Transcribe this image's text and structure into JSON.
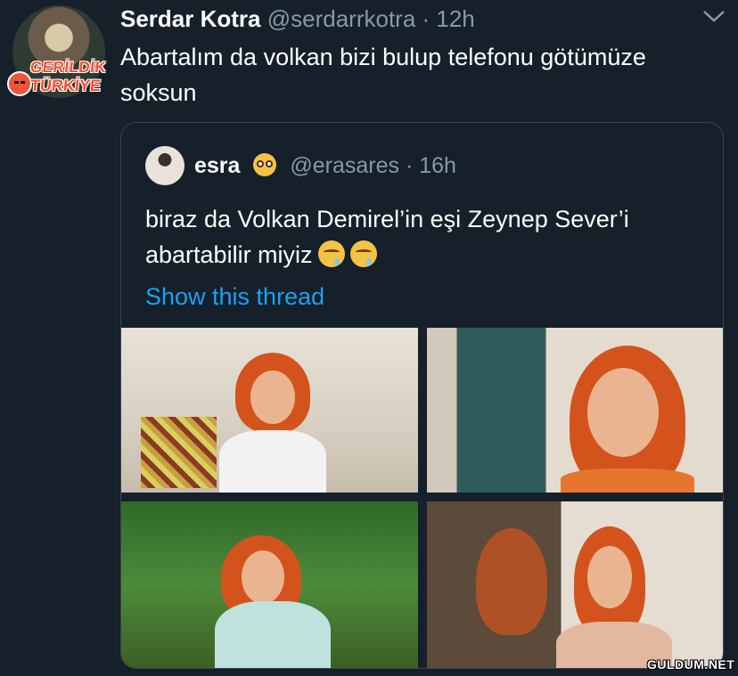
{
  "tweet": {
    "author_name": "Serdar Kotra",
    "author_meta": "@serdarrkotra · 12h",
    "text": "Abartalım da volkan bizi bulup telefonu götümüze soksun",
    "avatar_badge": [
      "GERİLDİK",
      "TÜRKİYE"
    ]
  },
  "quoted": {
    "author_name": "esra",
    "author_meta": "@erasares · 16h",
    "text": "biraz da Volkan Demirel’in eşi Zeynep Sever’i abartabilir miyiz",
    "emoji_after_name": "pleading-face",
    "emojis_after_text": [
      "drooling-face",
      "drooling-face"
    ],
    "show_thread": "Show this thread",
    "photos": [
      "woman with red hair making peace signs",
      "woman with red hair smiling close-up",
      "woman with red hair and sunglasses outdoors",
      "woman with red hair and mirror reflection"
    ]
  },
  "watermark": "GULDUM.NET",
  "colors": {
    "background": "#15202b",
    "text": "#ffffff",
    "secondary_text": "#8899a6",
    "link": "#1da1f2",
    "border": "#38444d"
  }
}
